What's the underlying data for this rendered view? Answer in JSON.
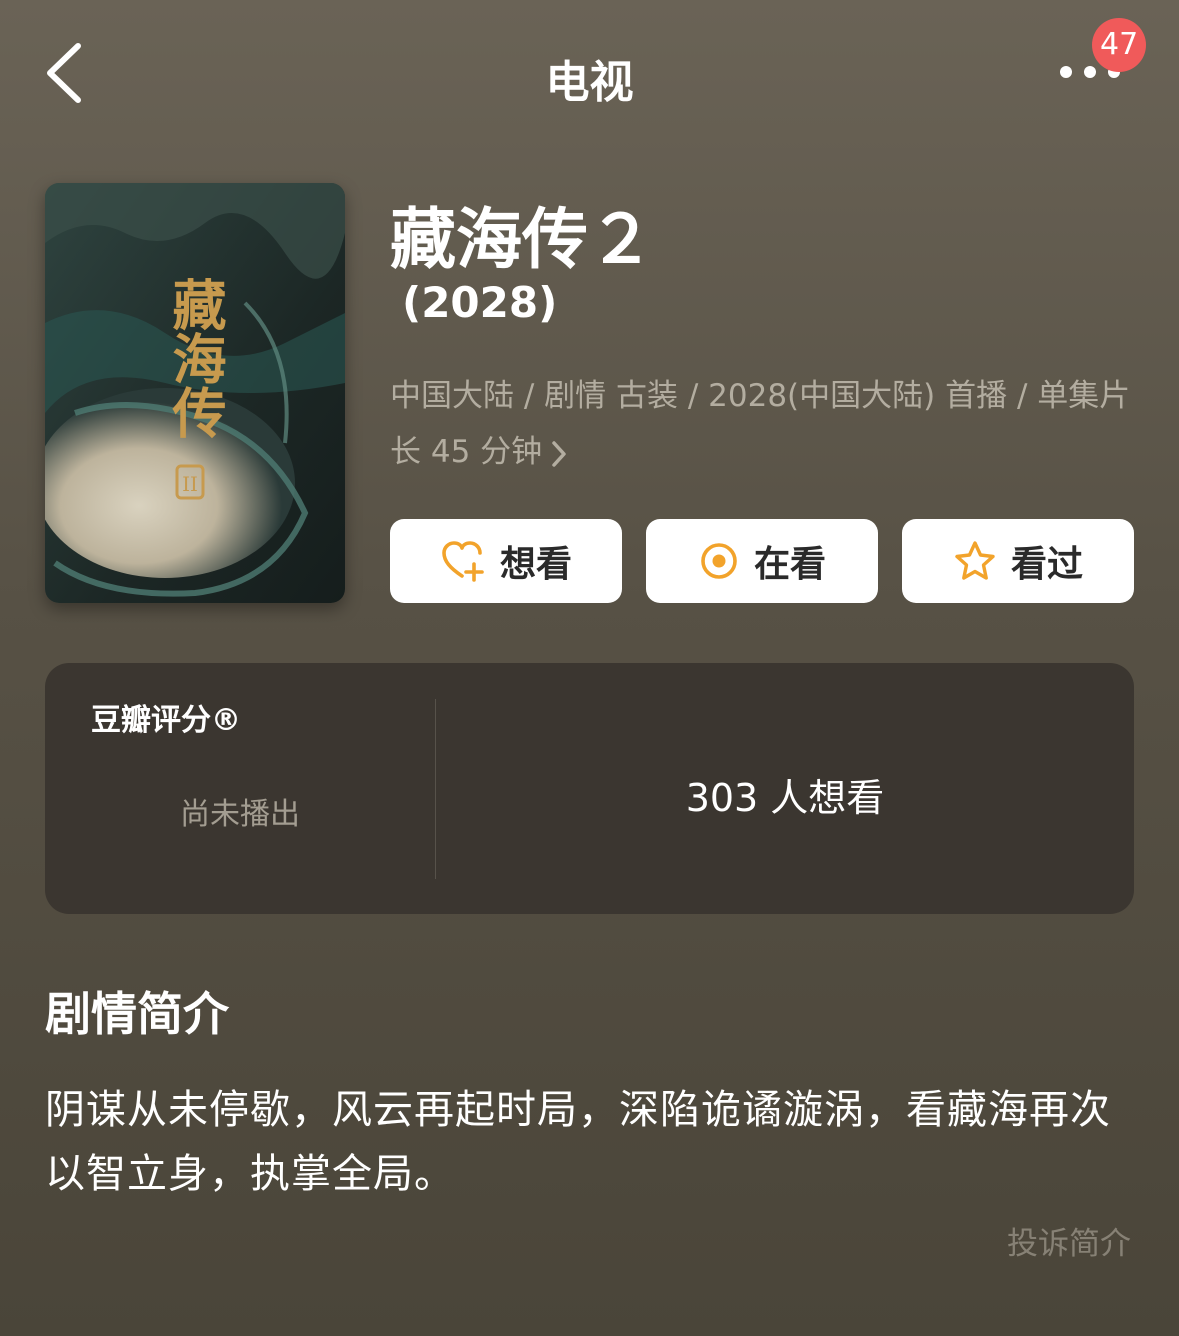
{
  "nav": {
    "title": "电视",
    "badge_count": "47",
    "back_icon": "chevron-left-icon",
    "more_icon": "more-dots-icon"
  },
  "movie": {
    "title": "藏海传２",
    "year": "(2028)",
    "meta": "中国大陆 / 剧情 古装 / 2028(中国大陆) 首播 / 单集片长 45 分钟",
    "poster_title": "藏海传",
    "poster_mark": "II"
  },
  "actions": [
    {
      "label": "想看",
      "icon": "heart-plus-icon"
    },
    {
      "label": "在看",
      "icon": "target-circle-icon"
    },
    {
      "label": "看过",
      "icon": "star-outline-icon"
    }
  ],
  "rating": {
    "label": "豆瓣评分®",
    "status": "尚未播出",
    "want_count": "303 人想看"
  },
  "synopsis": {
    "title": "剧情简介",
    "text": "阴谋从未停歇，风云再起时局，深陷诡谲漩涡，看藏海再次以智立身，执掌全局。",
    "report_label": "投诉简介"
  },
  "colors": {
    "background": "#5e584c",
    "card": "#3b3630",
    "accent_orange": "#f2a32b",
    "badge_red": "#f05a5a"
  }
}
